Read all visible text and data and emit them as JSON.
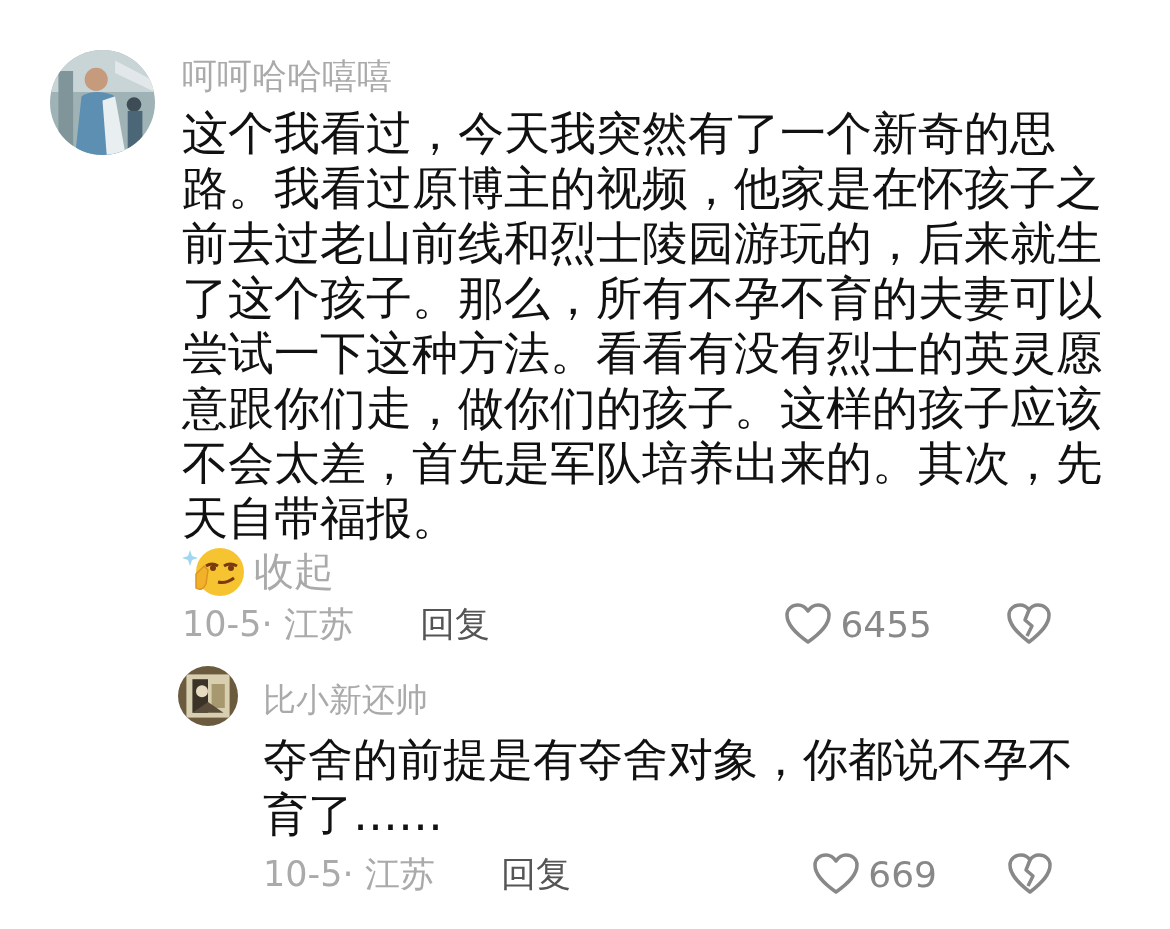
{
  "comments": [
    {
      "author": "呵呵哈哈嘻嘻",
      "text": "这个我看过，今天我突然有了一个新奇的思路。我看过原博主的视频，他家是在怀孩子之前去过老山前线和烈士陵园游玩的，后来就生了这个孩子。那么，所有不孕不育的夫妻可以尝试一下这种方法。看看有没有烈士的英灵愿意跟你们走，做你们的孩子。这样的孩子应该不会太差，首先是军队培养出来的。其次，先天自带福报。",
      "trailing_emoji": true,
      "collapse_label": "收起",
      "date_location": "10-5· 江苏",
      "reply_label": "回复",
      "likes": "6455",
      "replies": [
        {
          "author": "比小新还帅",
          "text": "夺舍的前提是有夺舍对象，你都说不孕不育了……",
          "date_location": "10-5· 江苏",
          "reply_label": "回复",
          "likes": "669"
        }
      ]
    }
  ]
}
